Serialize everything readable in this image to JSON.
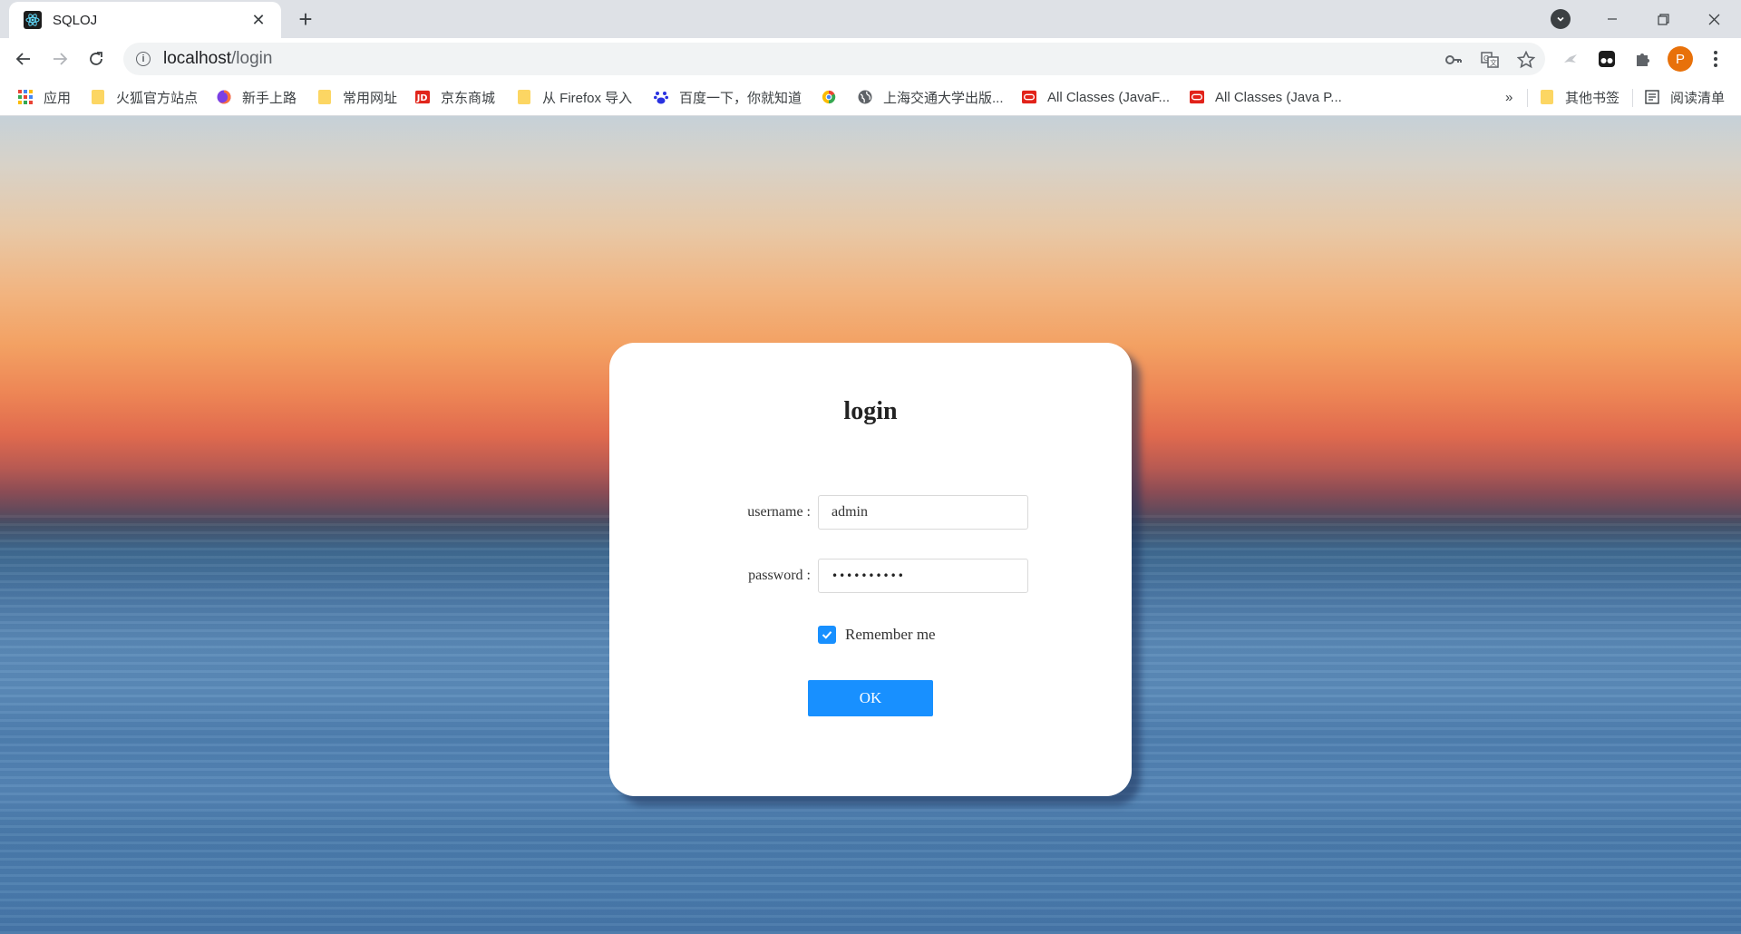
{
  "browser": {
    "tab": {
      "title": "SQLOJ",
      "favicon": "react-icon"
    },
    "new_tab_label": "+",
    "url": {
      "host": "localhost",
      "path": "/login"
    },
    "profile_initial": "P",
    "profile_color": "#e8710a",
    "bookmarks": [
      {
        "label": "应用",
        "icon": "apps-grid-icon"
      },
      {
        "label": "火狐官方站点",
        "icon": "folder-icon"
      },
      {
        "label": "新手上路",
        "icon": "firefox-icon"
      },
      {
        "label": "常用网址",
        "icon": "folder-icon"
      },
      {
        "label": "京东商城",
        "icon": "jd-icon"
      },
      {
        "label": "从 Firefox 导入",
        "icon": "folder-icon"
      },
      {
        "label": "百度一下，你就知道",
        "icon": "baidu-paw-icon"
      },
      {
        "label": "",
        "icon": "chrome-like-icon"
      },
      {
        "label": "上海交通大学出版...",
        "icon": "globe-icon"
      },
      {
        "label": "All Classes (JavaF...",
        "icon": "oracle-icon"
      },
      {
        "label": "All Classes (Java P...",
        "icon": "oracle-icon"
      }
    ],
    "overflow_label": "»",
    "other_bookmarks": "其他书签",
    "reading_list": "阅读清单"
  },
  "login": {
    "title": "login",
    "username_label": "username :",
    "username_value": "admin",
    "password_label": "password :",
    "password_value": "••••••••••",
    "remember_label": "Remember me",
    "remember_checked": true,
    "ok_label": "OK"
  },
  "colors": {
    "accent": "#1890ff",
    "oracle_red": "#e2231a",
    "jd_red": "#e1251b",
    "folder_yellow": "#fcd663"
  }
}
